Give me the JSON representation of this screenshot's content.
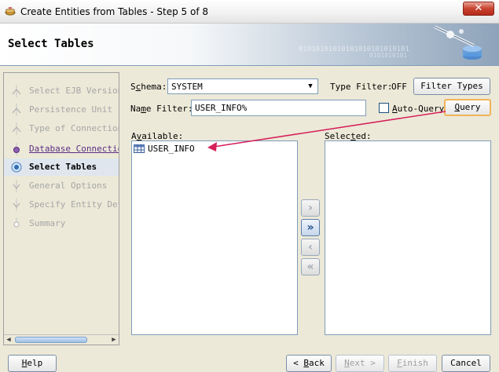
{
  "window": {
    "title": "Create Entities from Tables - Step 5 of 8",
    "close_glyph": "✕"
  },
  "header": {
    "page_title": "Select Tables",
    "binary_text_1": "01010101010101010101010101",
    "binary_text_2": "0101010101"
  },
  "nav": {
    "steps": [
      {
        "label": "Select EJB Version",
        "state": "pending"
      },
      {
        "label": "Persistence Unit",
        "state": "pending"
      },
      {
        "label": "Type of Connection",
        "state": "pending"
      },
      {
        "label": "Database Connection",
        "state": "visited"
      },
      {
        "label": "Select Tables",
        "state": "current"
      },
      {
        "label": "General Options",
        "state": "pending"
      },
      {
        "label": "Specify Entity Deta",
        "state": "pending"
      },
      {
        "label": "Summary",
        "state": "pending"
      }
    ]
  },
  "form": {
    "schema_label_pre": "S",
    "schema_label_u": "c",
    "schema_label_post": "hema:",
    "schema_value": "SYSTEM",
    "type_filter_label": "Type Filter:",
    "type_filter_value": "OFF",
    "filter_types_button": "Filter Types",
    "name_filter_label_pre": "Na",
    "name_filter_label_u": "m",
    "name_filter_label_post": "e Filter:",
    "name_filter_value": "USER_INFO%",
    "auto_query_label_pre": "",
    "auto_query_label_u": "A",
    "auto_query_label_post": "uto-Query",
    "auto_query_checked": false,
    "query_button_u": "Q",
    "query_button_post": "uery"
  },
  "lists": {
    "available_label_pre": "A",
    "available_label_u": "v",
    "available_label_post": "ailable:",
    "available_items": [
      "USER_INFO"
    ],
    "selected_label_pre": "Selec",
    "selected_label_u": "t",
    "selected_label_post": "ed:",
    "selected_items": []
  },
  "shuttle": {
    "move_one": "›",
    "move_all": "»",
    "remove_one": "‹",
    "remove_all": "«"
  },
  "footer": {
    "help_u": "H",
    "help_post": "elp",
    "back_pre": "< ",
    "back_u": "B",
    "back_post": "ack",
    "next_u": "N",
    "next_post": "ext >",
    "finish_u": "F",
    "finish_post": "inish",
    "cancel": "Cancel"
  },
  "colors": {
    "annotation_arrow": "#d6205a",
    "visited_step": "#5a2d82",
    "accent_blue": "#1f4f8f"
  }
}
